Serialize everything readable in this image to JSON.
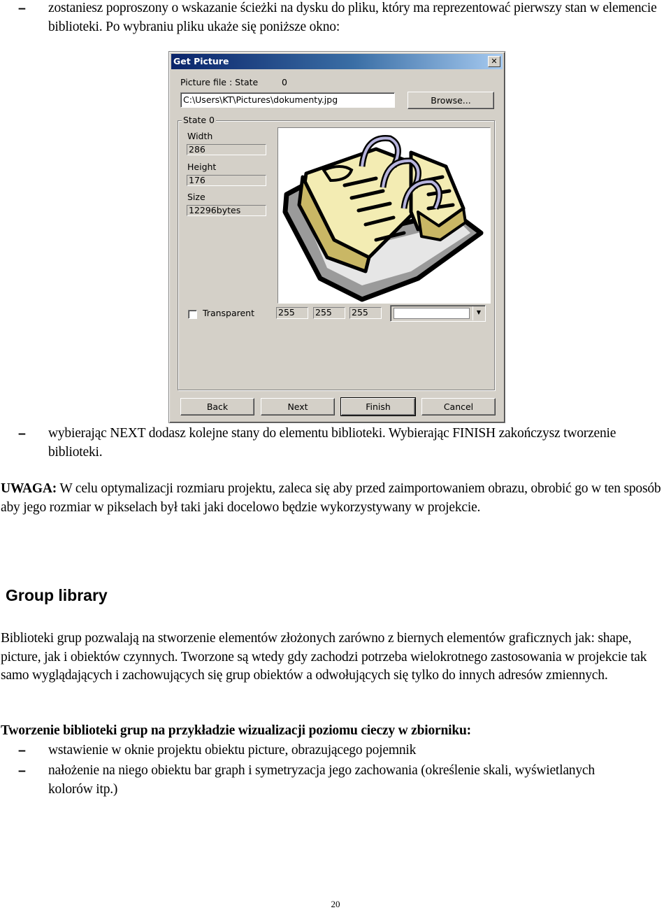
{
  "document": {
    "intro_bullet": "zostaniesz poproszony o wskazanie ścieżki na dysku do pliku, który ma reprezentować pierwszy stan w elemencie biblioteki. Po wybraniu pliku ukaże się poniższe okno:",
    "bullet_dash": "–",
    "next_bullet": "wybierając NEXT dodasz kolejne stany do elementu biblioteki. Wybierając FINISH zakończysz tworzenie biblioteki.",
    "note_label": "UWAGA:",
    "note_text": " W celu optymalizacji rozmiaru projektu, zaleca się aby przed zaimportowaniem obrazu, obrobić go w ten sposób aby jego rozmiar w pikselach był taki jaki docelowo będzie wykorzystywany w projekcie.",
    "section_heading": "Group library",
    "section_paragraph": "Biblioteki grup pozwalają na stworzenie elementów złożonych zarówno z biernych elementów graficznych jak: shape, picture, jak i obiektów czynnych. Tworzone są wtedy gdy zachodzi potrzeba wielokrotnego zastosowania w projekcie tak samo wyglądających i zachowujących się grup obiektów a odwołujących się tylko do innych adresów zmiennych.",
    "example_heading": "Tworzenie biblioteki grup na przykładzie wizualizacji poziomu cieczy  w zbiorniku:",
    "example_bullets": [
      "wstawienie w oknie projektu obiektu picture, obrazującego pojemnik",
      "nałożenie na niego obiektu bar graph i symetryzacja jego zachowania (określenie skali, wyświetlanych kolorów itp.)"
    ],
    "page_number": "20"
  },
  "dialog": {
    "title": "Get Picture",
    "close_glyph": "✕",
    "picture_file_label": "Picture file : State",
    "picture_file_state": "0",
    "file_path": "C:\\Users\\KT\\Pictures\\dokumenty.jpg",
    "browse_label": "Browse...",
    "state_group_title": "State 0",
    "width_label": "Width",
    "width_value": "286",
    "height_label": "Height",
    "height_value": "176",
    "size_label": "Size",
    "size_value": "12296bytes",
    "picture_alt": "clip-art of an open ring-bound agenda book",
    "transparent_label": "Transparent",
    "transparent_checked": false,
    "rgb": [
      "255",
      "255",
      "255"
    ],
    "color_dropdown_arrow": "▼",
    "buttons": {
      "back": "Back",
      "next": "Next",
      "finish": "Finish",
      "cancel": "Cancel"
    },
    "colors": {
      "titlebar_start": "#0a246a",
      "titlebar_end": "#a6caf0",
      "face": "#d4d0c8"
    }
  }
}
